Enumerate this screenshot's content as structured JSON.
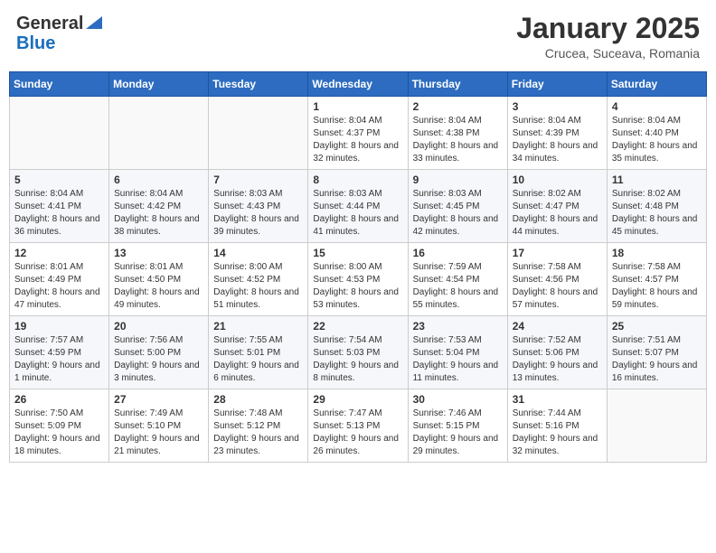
{
  "header": {
    "logo_general": "General",
    "logo_blue": "Blue",
    "month_title": "January 2025",
    "location": "Crucea, Suceava, Romania"
  },
  "weekdays": [
    "Sunday",
    "Monday",
    "Tuesday",
    "Wednesday",
    "Thursday",
    "Friday",
    "Saturday"
  ],
  "weeks": [
    [
      {
        "day": "",
        "info": ""
      },
      {
        "day": "",
        "info": ""
      },
      {
        "day": "",
        "info": ""
      },
      {
        "day": "1",
        "info": "Sunrise: 8:04 AM\nSunset: 4:37 PM\nDaylight: 8 hours and 32 minutes."
      },
      {
        "day": "2",
        "info": "Sunrise: 8:04 AM\nSunset: 4:38 PM\nDaylight: 8 hours and 33 minutes."
      },
      {
        "day": "3",
        "info": "Sunrise: 8:04 AM\nSunset: 4:39 PM\nDaylight: 8 hours and 34 minutes."
      },
      {
        "day": "4",
        "info": "Sunrise: 8:04 AM\nSunset: 4:40 PM\nDaylight: 8 hours and 35 minutes."
      }
    ],
    [
      {
        "day": "5",
        "info": "Sunrise: 8:04 AM\nSunset: 4:41 PM\nDaylight: 8 hours and 36 minutes."
      },
      {
        "day": "6",
        "info": "Sunrise: 8:04 AM\nSunset: 4:42 PM\nDaylight: 8 hours and 38 minutes."
      },
      {
        "day": "7",
        "info": "Sunrise: 8:03 AM\nSunset: 4:43 PM\nDaylight: 8 hours and 39 minutes."
      },
      {
        "day": "8",
        "info": "Sunrise: 8:03 AM\nSunset: 4:44 PM\nDaylight: 8 hours and 41 minutes."
      },
      {
        "day": "9",
        "info": "Sunrise: 8:03 AM\nSunset: 4:45 PM\nDaylight: 8 hours and 42 minutes."
      },
      {
        "day": "10",
        "info": "Sunrise: 8:02 AM\nSunset: 4:47 PM\nDaylight: 8 hours and 44 minutes."
      },
      {
        "day": "11",
        "info": "Sunrise: 8:02 AM\nSunset: 4:48 PM\nDaylight: 8 hours and 45 minutes."
      }
    ],
    [
      {
        "day": "12",
        "info": "Sunrise: 8:01 AM\nSunset: 4:49 PM\nDaylight: 8 hours and 47 minutes."
      },
      {
        "day": "13",
        "info": "Sunrise: 8:01 AM\nSunset: 4:50 PM\nDaylight: 8 hours and 49 minutes."
      },
      {
        "day": "14",
        "info": "Sunrise: 8:00 AM\nSunset: 4:52 PM\nDaylight: 8 hours and 51 minutes."
      },
      {
        "day": "15",
        "info": "Sunrise: 8:00 AM\nSunset: 4:53 PM\nDaylight: 8 hours and 53 minutes."
      },
      {
        "day": "16",
        "info": "Sunrise: 7:59 AM\nSunset: 4:54 PM\nDaylight: 8 hours and 55 minutes."
      },
      {
        "day": "17",
        "info": "Sunrise: 7:58 AM\nSunset: 4:56 PM\nDaylight: 8 hours and 57 minutes."
      },
      {
        "day": "18",
        "info": "Sunrise: 7:58 AM\nSunset: 4:57 PM\nDaylight: 8 hours and 59 minutes."
      }
    ],
    [
      {
        "day": "19",
        "info": "Sunrise: 7:57 AM\nSunset: 4:59 PM\nDaylight: 9 hours and 1 minute."
      },
      {
        "day": "20",
        "info": "Sunrise: 7:56 AM\nSunset: 5:00 PM\nDaylight: 9 hours and 3 minutes."
      },
      {
        "day": "21",
        "info": "Sunrise: 7:55 AM\nSunset: 5:01 PM\nDaylight: 9 hours and 6 minutes."
      },
      {
        "day": "22",
        "info": "Sunrise: 7:54 AM\nSunset: 5:03 PM\nDaylight: 9 hours and 8 minutes."
      },
      {
        "day": "23",
        "info": "Sunrise: 7:53 AM\nSunset: 5:04 PM\nDaylight: 9 hours and 11 minutes."
      },
      {
        "day": "24",
        "info": "Sunrise: 7:52 AM\nSunset: 5:06 PM\nDaylight: 9 hours and 13 minutes."
      },
      {
        "day": "25",
        "info": "Sunrise: 7:51 AM\nSunset: 5:07 PM\nDaylight: 9 hours and 16 minutes."
      }
    ],
    [
      {
        "day": "26",
        "info": "Sunrise: 7:50 AM\nSunset: 5:09 PM\nDaylight: 9 hours and 18 minutes."
      },
      {
        "day": "27",
        "info": "Sunrise: 7:49 AM\nSunset: 5:10 PM\nDaylight: 9 hours and 21 minutes."
      },
      {
        "day": "28",
        "info": "Sunrise: 7:48 AM\nSunset: 5:12 PM\nDaylight: 9 hours and 23 minutes."
      },
      {
        "day": "29",
        "info": "Sunrise: 7:47 AM\nSunset: 5:13 PM\nDaylight: 9 hours and 26 minutes."
      },
      {
        "day": "30",
        "info": "Sunrise: 7:46 AM\nSunset: 5:15 PM\nDaylight: 9 hours and 29 minutes."
      },
      {
        "day": "31",
        "info": "Sunrise: 7:44 AM\nSunset: 5:16 PM\nDaylight: 9 hours and 32 minutes."
      },
      {
        "day": "",
        "info": ""
      }
    ]
  ]
}
